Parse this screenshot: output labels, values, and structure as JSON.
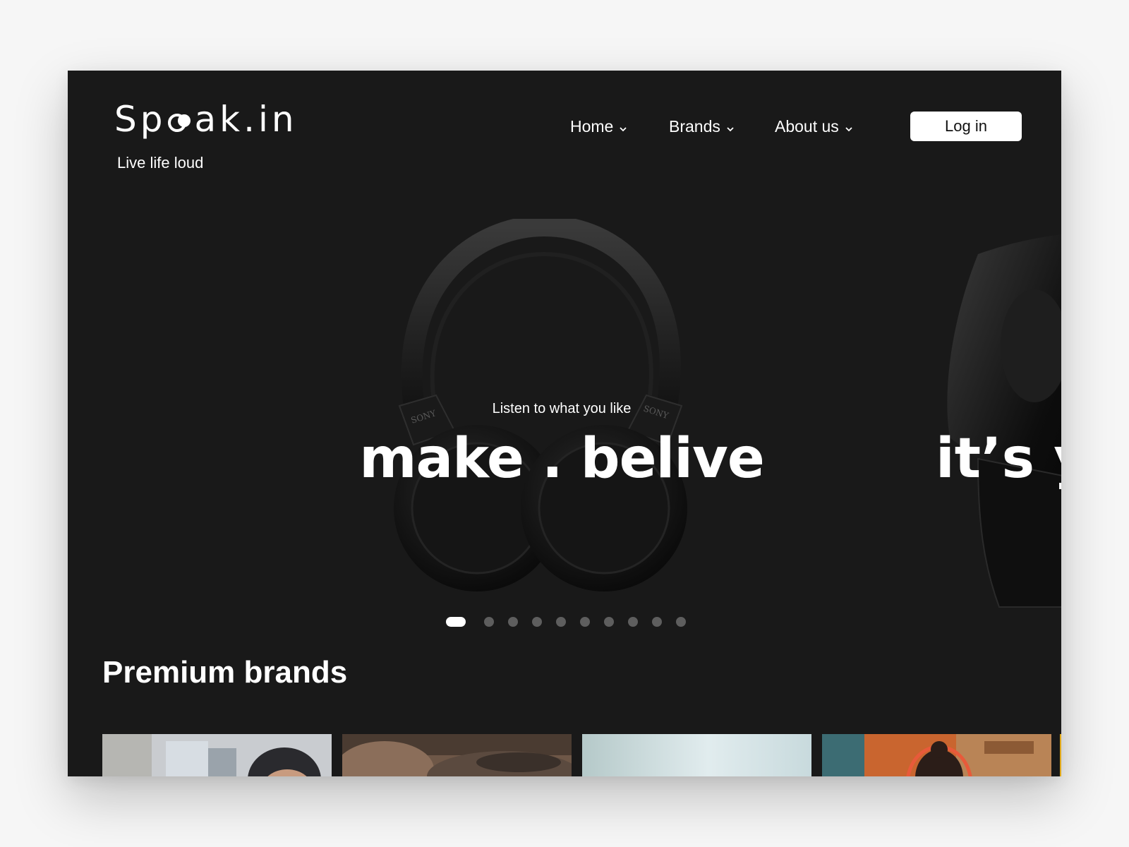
{
  "brand": {
    "logo_prefix": "Sp",
    "logo_suffix": "ak.in",
    "tagline": "Live life loud"
  },
  "nav": {
    "items": [
      {
        "label": "Home"
      },
      {
        "label": "Brands"
      },
      {
        "label": "About us"
      }
    ],
    "login_label": "Log in"
  },
  "hero": {
    "subtitle": "Listen to what you like",
    "title": "make . belive",
    "next_title": "it’s y",
    "product_brand": "SONY",
    "active_slide": 1,
    "slide_count": 10
  },
  "brands_section": {
    "title": "Premium brands"
  },
  "colors": {
    "background": "#191919",
    "text": "#ffffff",
    "dot_inactive": "#5e5e5e",
    "login_bg": "#ffffff"
  }
}
